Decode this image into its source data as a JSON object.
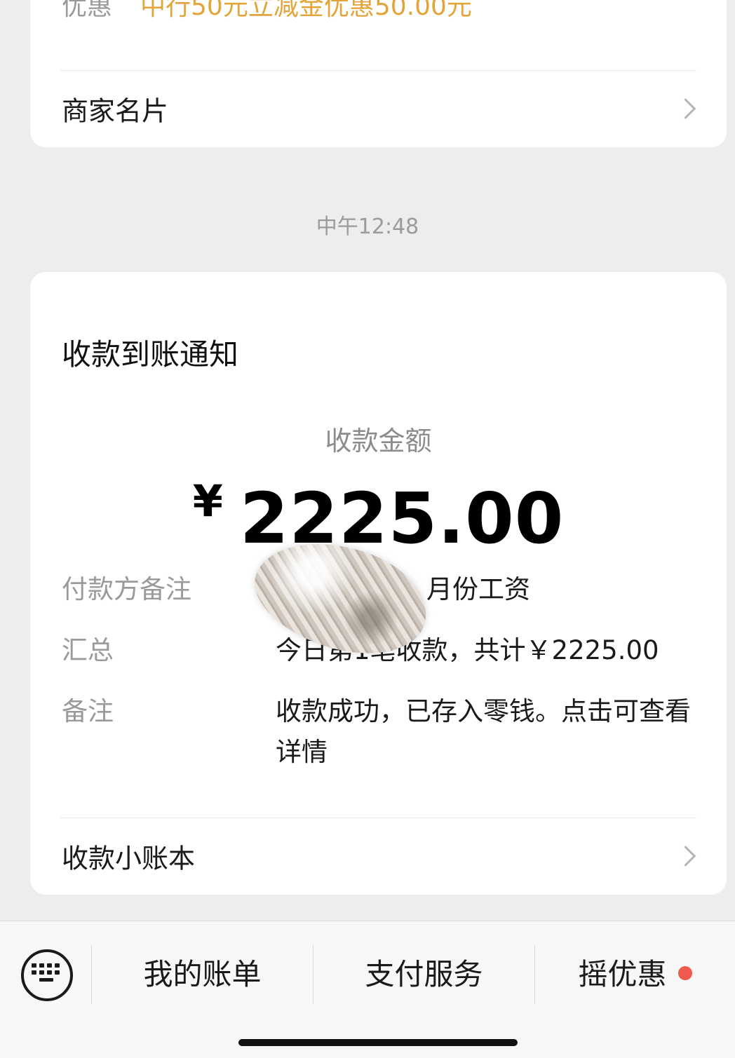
{
  "top_card": {
    "discount_label": "优惠",
    "discount_value": "中行50元立减金优惠50.00元",
    "merchant_card_label": "商家名片"
  },
  "timestamp": "中午12:48",
  "notification": {
    "title": "收款到账通知",
    "amount_label": "收款金额",
    "currency_symbol": "¥",
    "amount": "2225.00",
    "rows": [
      {
        "key": "付款方备注",
        "value": "月份工资"
      },
      {
        "key": "汇总",
        "value": "今日第1笔收款，共计￥2225.00"
      },
      {
        "key": "备注",
        "value": "收款成功，已存入零钱。点击可查看详情"
      }
    ],
    "ledger_label": "收款小账本"
  },
  "bottom_bar": {
    "keyboard_icon": "keyboard-icon",
    "tabs": [
      "我的账单",
      "支付服务",
      "摇优惠"
    ],
    "badge_color": "#f05a4e"
  }
}
